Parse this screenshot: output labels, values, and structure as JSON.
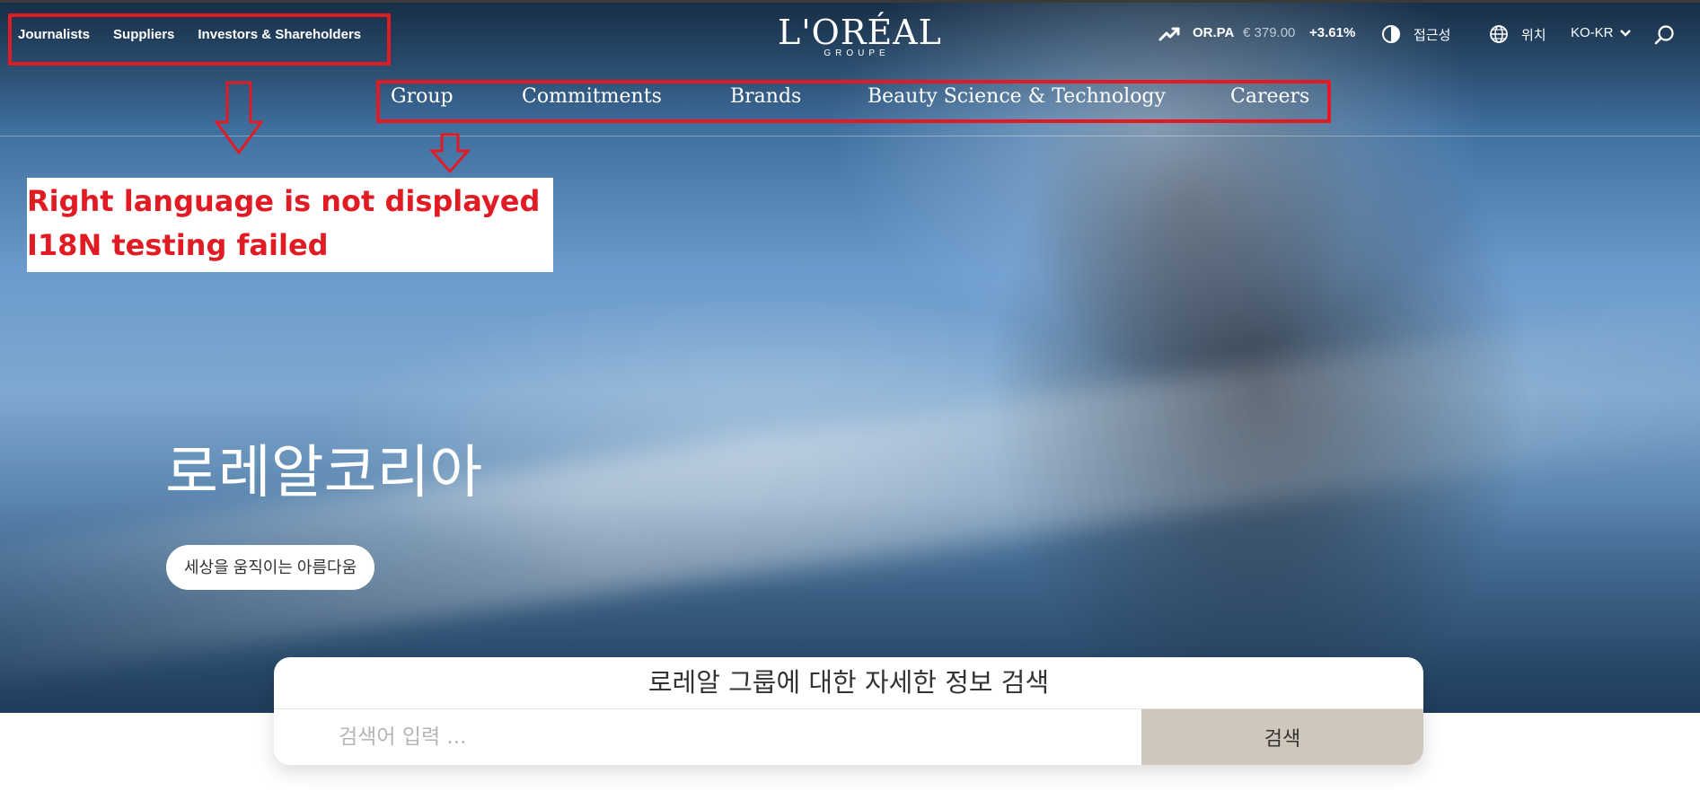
{
  "utility_links": [
    "Journalists",
    "Suppliers",
    "Investors & Shareholders"
  ],
  "logo": {
    "main": "L'ORÉAL",
    "sub": "GROUPE"
  },
  "ticker": {
    "symbol": "OR.PA",
    "price": "€ 379.00",
    "change": "+3.61%"
  },
  "tools": {
    "accessibility_label": "접근성",
    "location_label": "위치",
    "language": "KO-KR"
  },
  "main_nav": [
    "Group",
    "Commitments",
    "Brands",
    "Beauty Science & Technology",
    "Careers"
  ],
  "annotation": {
    "line1": "Right language is not displayed",
    "line2": "I18N testing failed",
    "color": "#e01b24"
  },
  "hero": {
    "title": "로레알코리아",
    "pill": "세상을 움직이는 아름다움"
  },
  "search": {
    "title": "로레알 그룹에 대한 자세한 정보 검색",
    "placeholder": "검색어 입력 ...",
    "button": "검색"
  },
  "icons": [
    "trend-up-icon",
    "contrast-icon",
    "globe-icon",
    "chevron-down-icon",
    "search-icon",
    "down-arrow-icon"
  ]
}
